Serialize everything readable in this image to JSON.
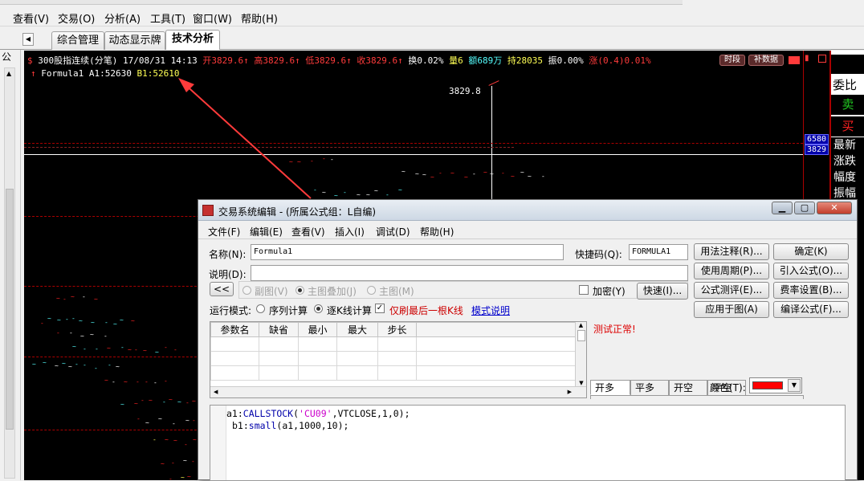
{
  "menubar": {
    "items": [
      "查看(V)",
      "交易(O)",
      "分析(A)",
      "工具(T)",
      "窗口(W)",
      "帮助(H)"
    ]
  },
  "tabs": [
    "综合管理",
    "动态显示牌",
    "技术分析"
  ],
  "left_panel": {
    "close_glyph": "×",
    "label": "公"
  },
  "chart": {
    "header": {
      "symbol": "300股指连续(分笔)",
      "date": "17/08/31",
      "time": "14:13",
      "open": "开3829.6",
      "high": "高3829.6",
      "low": "低3829.6",
      "close": "收3829.6",
      "turnover": "换0.02%",
      "volume": "量6",
      "amount": "额689万",
      "position": "持28035",
      "amplitude": "振0.00%",
      "change": "涨(0.4)0.01%",
      "btn_time": "时段",
      "btn_supplement": "补数据"
    },
    "formula_line": {
      "name": "Formula1",
      "a1": "A1:52630",
      "b1": "B1:52610"
    },
    "price_label": "3829.8",
    "right_badges": [
      "6580",
      "3829"
    ],
    "colors": {
      "background": "#000000",
      "up": "#ff2222",
      "ref": "#ffffff",
      "yellow": "#ffff55",
      "cyan": "#55ffff",
      "accent": "#ff3b3b"
    }
  },
  "order_panel": {
    "title": "委比",
    "sell": "卖",
    "buy": "买",
    "labels": [
      "最新",
      "涨跌",
      "幅度",
      "振幅"
    ]
  },
  "dialog": {
    "title": "交易系统编辑 - (所属公式组：L自编)",
    "menu": [
      "文件(F)",
      "编辑(E)",
      "查看(V)",
      "插入(I)",
      "调试(D)",
      "帮助(H)"
    ],
    "name_label": "名称(N):",
    "name_value": "Formula1",
    "shortcut_label": "快捷码(Q):",
    "shortcut_value": "FORMULA1",
    "desc_label": "说明(D):",
    "desc_value": "",
    "collapse_btn": "<<",
    "overlay_options": [
      "副图(V)",
      "主图叠加(J)",
      "主图(M)"
    ],
    "encrypt_label": "加密(Y)",
    "fast_btn": "快速(I)...",
    "run_mode_label": "运行模式:",
    "run_modes": [
      "序列计算",
      "逐K线计算"
    ],
    "refresh_last_label": "仅刷最后一根K线",
    "mode_help_link": "模式说明",
    "param_headers": [
      "参数名",
      "缺省",
      "最小",
      "最大",
      "步长"
    ],
    "status": "测试正常!",
    "buttons": {
      "usage": "用法注释(R)...",
      "confirm": "确定(K)",
      "cycle": "使用周期(P)...",
      "import": "引入公式(O)...",
      "test": "公式测评(E)...",
      "fee": "费率设置(B)...",
      "apply": "应用于图(A)",
      "compile": "编译公式(F)..."
    },
    "signal_tabs": [
      "开多",
      "平多",
      "开空",
      "平空"
    ],
    "color_label": "颜色(T):",
    "color_value": "#ff0000",
    "code_lines": [
      {
        "prefix": "a1:",
        "func": "CALLSTOCK",
        "p1": "(",
        "str": "'CU09'",
        "p2": ",VTCLOSE,1,0);"
      },
      {
        "prefix": "b1:",
        "func": "small",
        "p1": "(a1,1000,10);",
        "str": "",
        "p2": ""
      }
    ]
  }
}
